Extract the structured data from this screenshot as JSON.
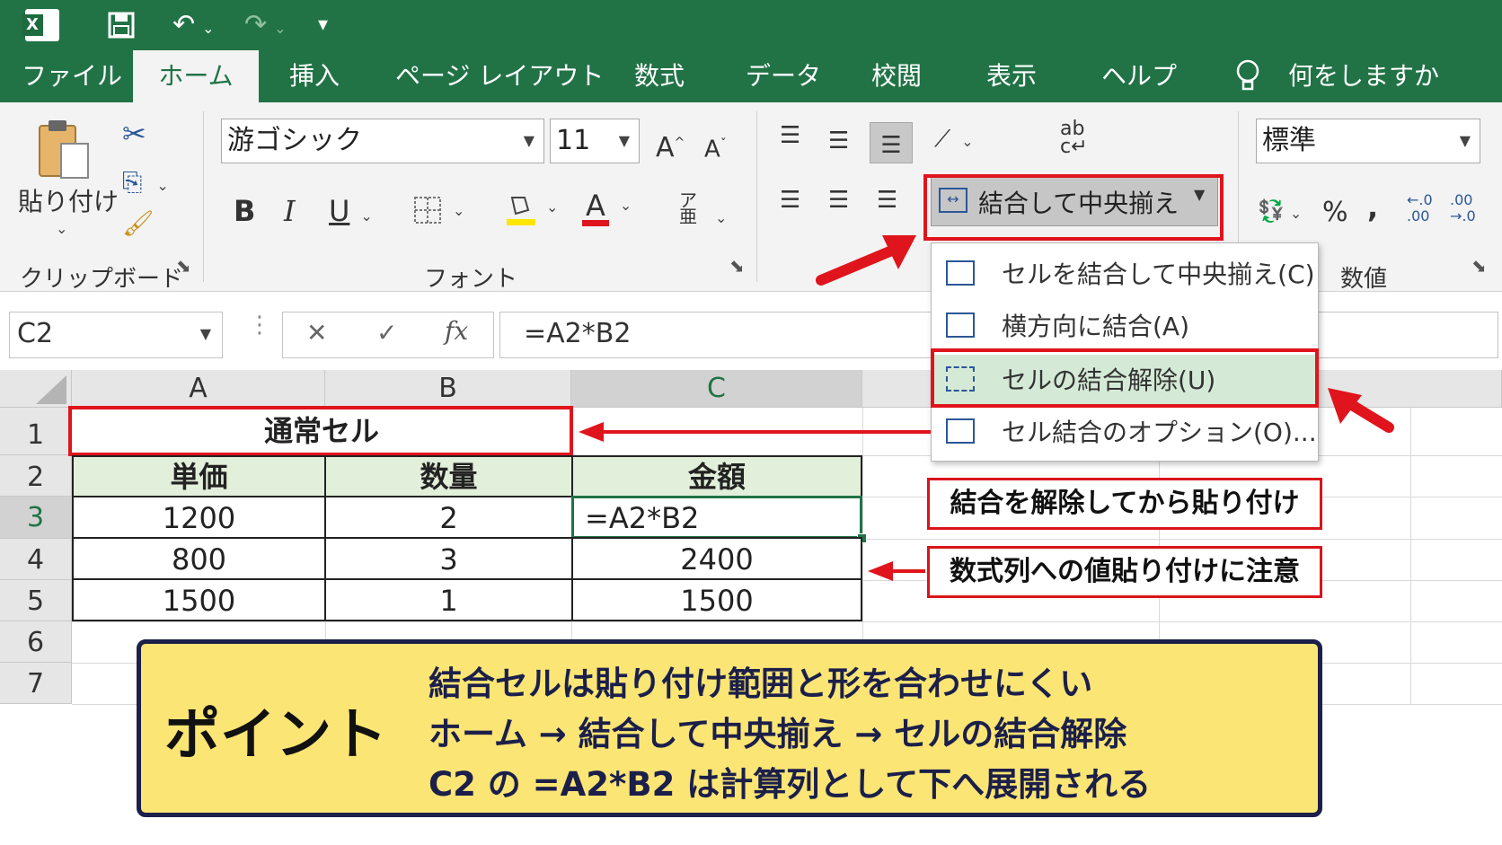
{
  "quick_access": {
    "save": "save-icon",
    "undo": "undo-icon",
    "redo": "redo-icon",
    "customize": "▾"
  },
  "tabs": [
    "ファイル",
    "ホーム",
    "挿入",
    "ページ レイアウト",
    "数式",
    "データ",
    "校閲",
    "表示",
    "ヘルプ"
  ],
  "tell_me": "何をしますか",
  "ribbon": {
    "clipboard": {
      "paste_label": "貼り付け",
      "group_label": "クリップボード"
    },
    "font": {
      "font_name": "游ゴシック",
      "font_size": "11",
      "group_label": "フォント",
      "grow": "A",
      "shrink": "A",
      "bold": "B",
      "italic": "I",
      "underline": "U",
      "font_color": "A"
    },
    "alignment": {
      "merge_label": "結合して中央揃え"
    },
    "number": {
      "format": "標準",
      "group_label": "数値",
      "percent": "%",
      "comma": ","
    }
  },
  "merge_menu": {
    "items": [
      "セルを結合して中央揃え(C)",
      "横方向に結合(A)",
      "セルの結合解除(U)",
      "セル結合のオプション(O)..."
    ]
  },
  "formula_bar": {
    "name_box": "C2",
    "cancel": "✕",
    "enter": "✓",
    "fx": "fx",
    "formula": "=A2*B2"
  },
  "grid": {
    "columns": [
      "A",
      "B",
      "C"
    ],
    "rows": [
      "1",
      "2",
      "3",
      "4",
      "5",
      "6",
      "7"
    ],
    "merged_title": "通常セル",
    "headers": [
      "単価",
      "数量",
      "金額"
    ],
    "data": [
      [
        "1200",
        "2",
        "=A2*B2"
      ],
      [
        "800",
        "3",
        "2400"
      ],
      [
        "1500",
        "1",
        "1500"
      ]
    ]
  },
  "callouts": {
    "unmerge_note": "結合を解除してから貼り付け",
    "formula_note": "数式列への値貼り付けに注意"
  },
  "point": {
    "label": "ポイント",
    "lines": [
      "結合セルは貼り付け範囲と形を合わせにくい",
      "ホーム → 結合して中央揃え → セルの結合解除",
      "C2 の =A2*B2 は計算列として下へ展開される"
    ]
  },
  "colors": {
    "excel_green": "#217346",
    "highlight_red": "#e0141c",
    "point_bg": "#fbe574",
    "header_fill": "#e2efda"
  }
}
